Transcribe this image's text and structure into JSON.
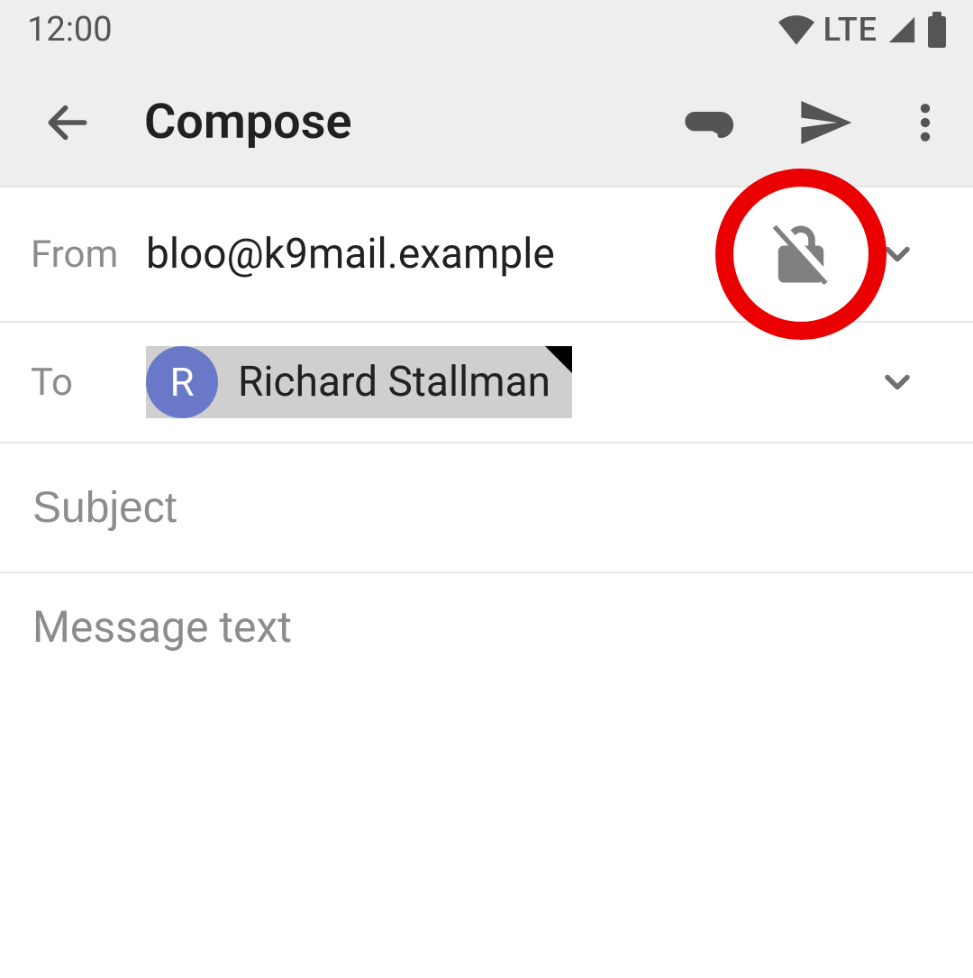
{
  "status_bar": {
    "time": "12:00",
    "network_label": "LTE"
  },
  "app_bar": {
    "title": "Compose"
  },
  "from": {
    "label": "From",
    "address": "bloo@k9mail.example"
  },
  "to": {
    "label": "To",
    "recipient": {
      "initial": "R",
      "name": "Richard Stallman"
    }
  },
  "subject": {
    "placeholder": "Subject",
    "value": ""
  },
  "body": {
    "placeholder": "Message text",
    "value": ""
  },
  "encryption": {
    "state": "disabled"
  }
}
